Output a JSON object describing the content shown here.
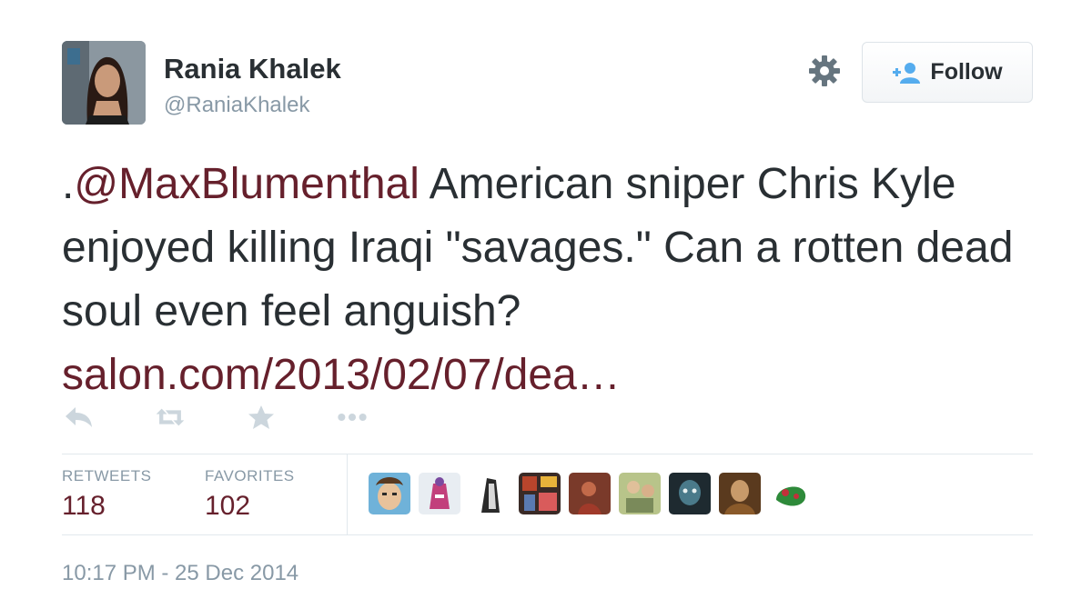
{
  "user": {
    "display_name": "Rania Khalek",
    "screen_name": "@RaniaKhalek"
  },
  "follow_button": {
    "label": "Follow",
    "icon": "add-user-icon"
  },
  "tweet": {
    "prefix": ".",
    "mention": "@MaxBlumenthal",
    "text": " American sniper Chris Kyle enjoyed killing Iraqi \"savages.\" Can a rotten dead soul even feel anguish? ",
    "link": "salon.com/2013/02/07/dea…"
  },
  "actions": [
    "reply-icon",
    "retweet-icon",
    "favorite-icon",
    "more-icon"
  ],
  "stats": {
    "retweets_label": "RETWEETS",
    "retweets_value": "118",
    "favorites_label": "FAVORITES",
    "favorites_value": "102"
  },
  "timestamp": "10:17 PM - 25 Dec 2014",
  "colors": {
    "link": "#66202c",
    "muted": "#8899a6",
    "text": "#292f33"
  }
}
